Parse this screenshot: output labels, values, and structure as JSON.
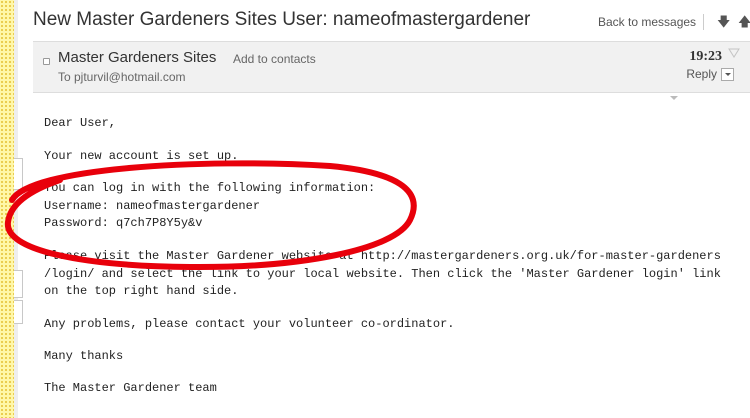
{
  "message": {
    "subject": "New Master Gardeners Sites User: nameofmastergardener",
    "back_label": "Back to messages",
    "nav_down_icon": "arrow-down-icon",
    "nav_up_icon": "arrow-up-icon"
  },
  "sender": {
    "name": "Master Gardeners Sites",
    "add_contact": "Add to contacts",
    "to": "To pjturvil@hotmail.com",
    "time": "19:23",
    "reply_label": "Reply",
    "flag_icon": "flag-icon"
  },
  "body": {
    "greeting": "Dear User,",
    "intro": "Your new account is set up.",
    "login_info": "You can log in with the following information:\nUsername: nameofmastergardener\nPassword: q7ch7P8Y5y&v",
    "instructions": "Please visit the Master Gardener website at http://mastergardeners.org.uk/for-master-gardeners\n/login/ and select the link to your local website. Then click the 'Master Gardener login' link\non the top right hand side.",
    "problems": "Any problems, please contact your volunteer co-ordinator.",
    "thanks": "Many thanks",
    "signature": "The Master Gardener team"
  },
  "colors": {
    "annotation": "#e8000b",
    "sender_box_bg": "#f1f1f1",
    "left_strip": "#fff7a8"
  }
}
